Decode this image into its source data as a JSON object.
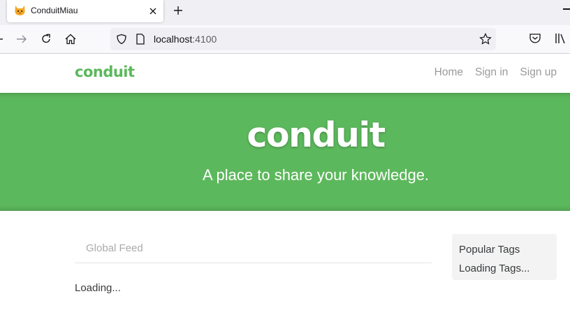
{
  "browser": {
    "tab_title": "ConduitMiau",
    "url_host": "localhost",
    "url_port": ":4100",
    "icons": {
      "favicon": "cat-favicon-icon",
      "close": "close-icon",
      "new_tab": "plus-icon",
      "back": "arrow-left-icon",
      "forward": "arrow-right-icon",
      "reload": "reload-icon",
      "home": "home-icon",
      "shield": "shield-icon",
      "page": "page-icon",
      "bookmark": "star-icon",
      "pocket": "pocket-icon",
      "library": "library-icon"
    }
  },
  "site": {
    "brand": "conduit",
    "nav": [
      "Home",
      "Sign in",
      "Sign up"
    ],
    "banner_title": "conduit",
    "banner_subtitle": "A place to share your knowledge.",
    "feed_tab": "Global Feed",
    "loading_text": "Loading...",
    "sidebar_title": "Popular Tags",
    "sidebar_loading": "Loading Tags...",
    "colors": {
      "brand_green": "#5cb85c",
      "muted": "#aaaaaa"
    }
  }
}
